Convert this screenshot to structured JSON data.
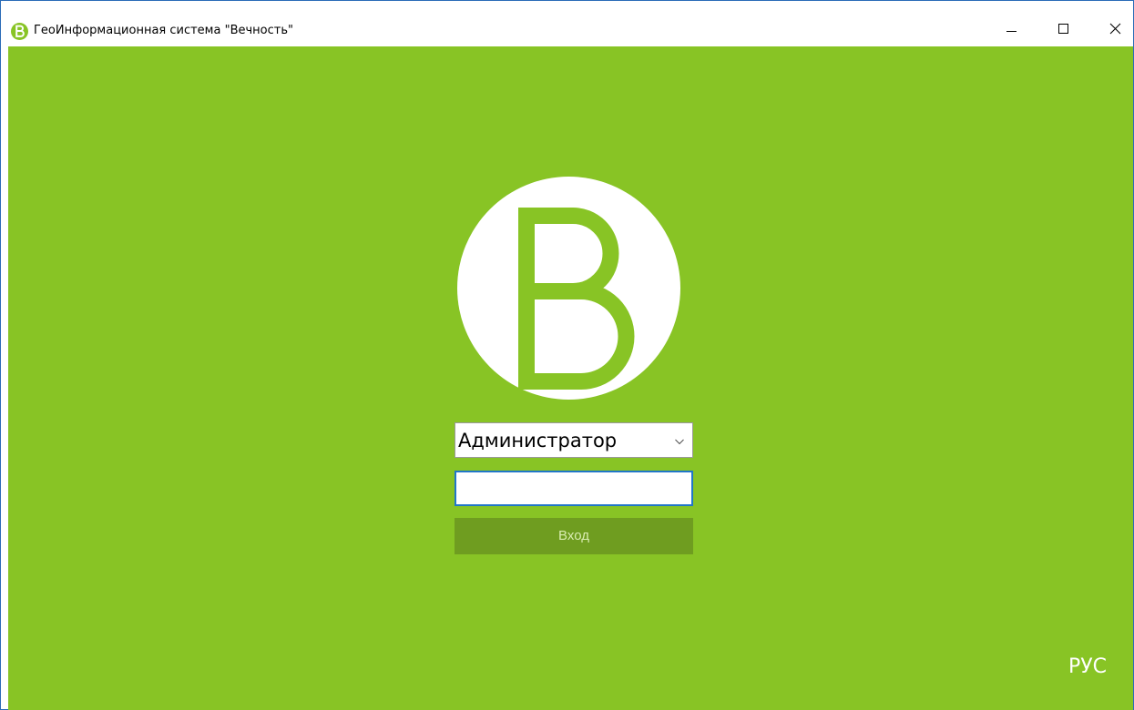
{
  "window": {
    "title": "ГеоИнформационная система \"Вечность\"",
    "app_icon": "app-logo-icon",
    "controls": [
      "minimize-icon",
      "maximize-icon",
      "close-icon"
    ]
  },
  "colors": {
    "background": "#88c425",
    "logo_circle": "#ffffff",
    "logo_letter": "#88c425",
    "button": "#6f9d20",
    "button_text": "#d8ecb0",
    "input_focus_border": "#2176c8"
  },
  "logo": {
    "letter": "B"
  },
  "login": {
    "role_selected": "Администратор",
    "password_value": "",
    "submit_label": "Вход"
  },
  "language": {
    "indicator": "РУС"
  }
}
